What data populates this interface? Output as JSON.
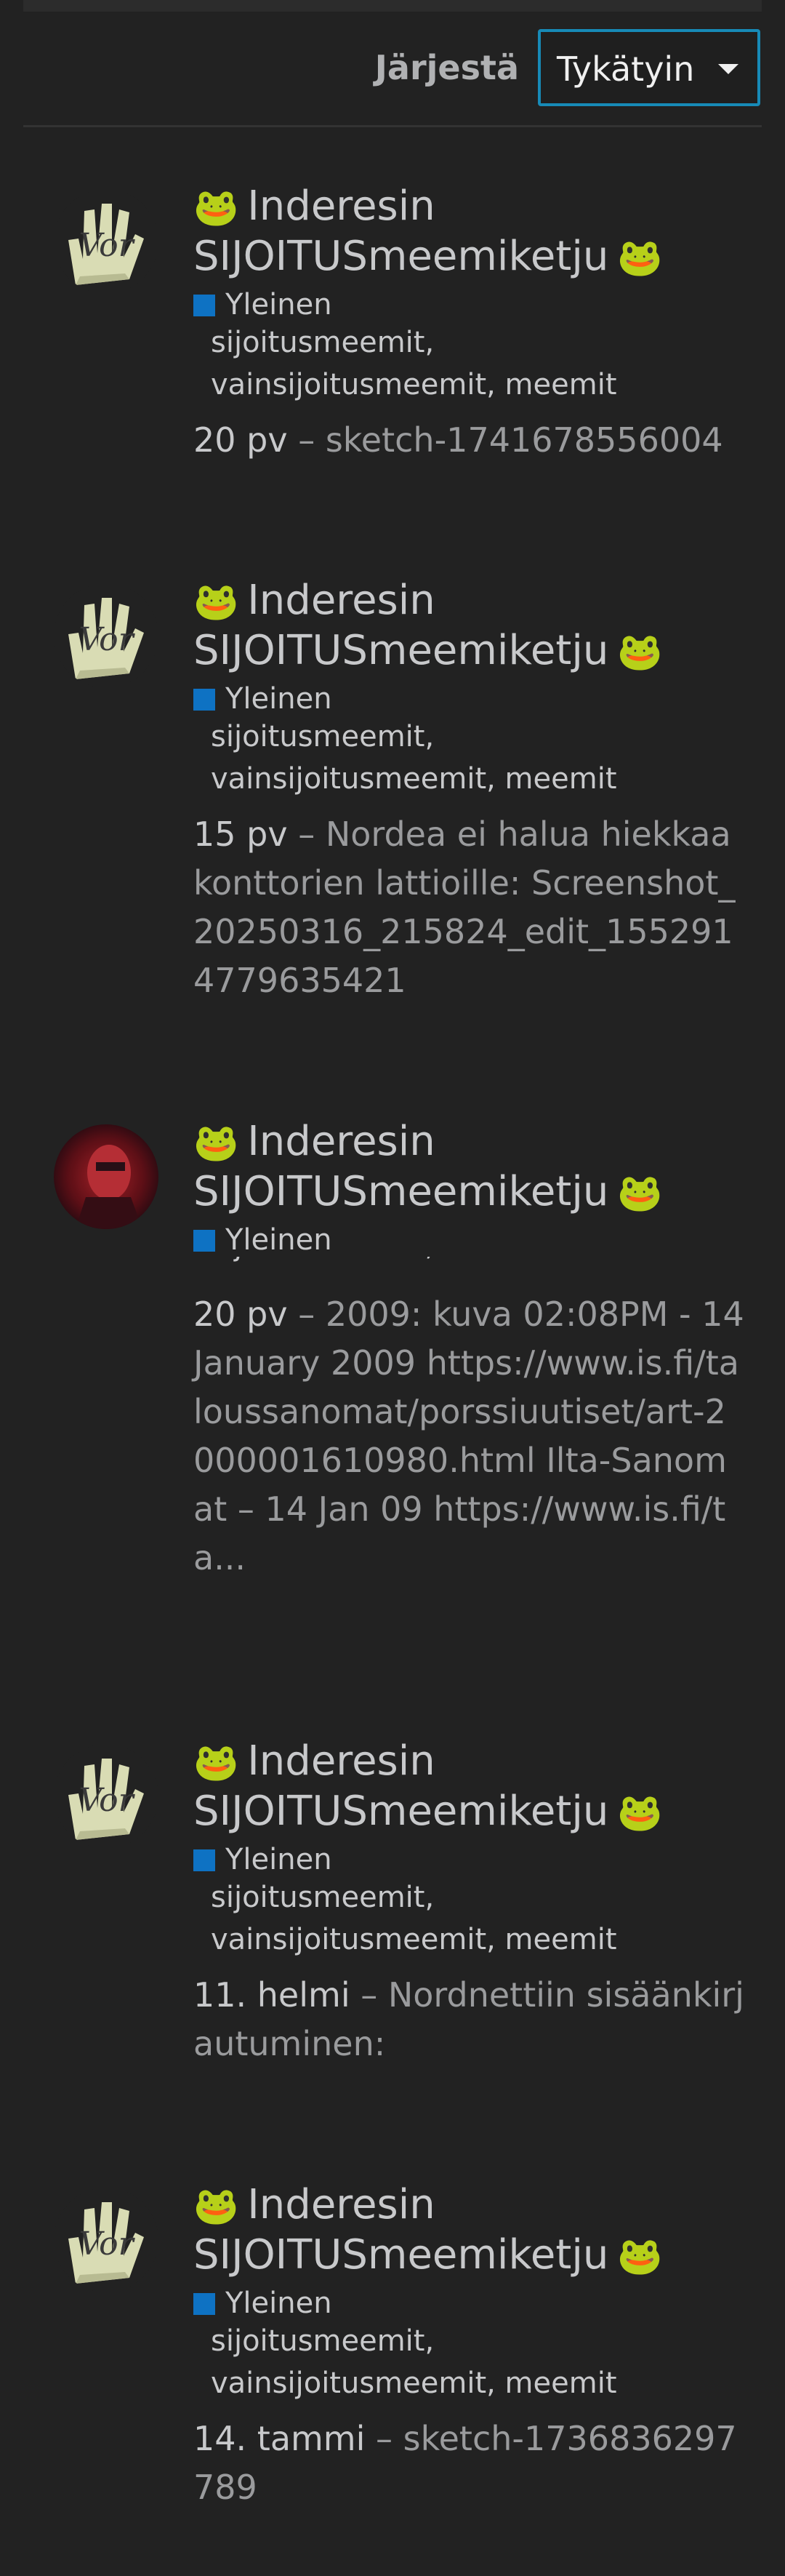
{
  "sort": {
    "label": "Järjestä",
    "selected": "Tykätyin"
  },
  "colors": {
    "background": "#222222",
    "accent": "#178ab7",
    "category": "#0e72c3"
  },
  "posts": [
    {
      "avatar_icon": "hand-avatar-icon",
      "title": "Inderesin SIJOITUSmeemiketju",
      "title_emoji": "🐸",
      "category": "Yleinen",
      "tags_line1": "sijoitusmeemit,",
      "tags_line2": "vainsijoitusmeemit, meemit",
      "date": "20 pv",
      "separator": " – ",
      "excerpt": "sketch-1741678556004"
    },
    {
      "avatar_icon": "hand-avatar-icon",
      "title": "Inderesin SIJOITUSmeemiketju",
      "title_emoji": "🐸",
      "category": "Yleinen",
      "tags_line1": "sijoitusmeemit,",
      "tags_line2": "vainsijoitusmeemit, meemit",
      "date": "15 pv",
      "separator": " – ",
      "excerpt": "Nordea ei halua hiekkaa konttorien lattioille: Screenshot_20250316_215824_edit_1552914779635421"
    },
    {
      "avatar_icon": "red-face-avatar-icon",
      "title": "Inderesin SIJOITUSmeemiketju",
      "title_emoji": "🐸",
      "category": "Yleinen",
      "tags_line1": "sijoitusmeemit,",
      "tags_line2": "",
      "date": "20 pv",
      "separator": " – ",
      "excerpt": "2009: kuva 02:08PM - 14 January 2009 https://www.is.fi/taloussanomat/porssiuutiset/art-2000001610980.html Ilta-Sanomat – 14 Jan 09 https://www.is.fi/ta..."
    },
    {
      "avatar_icon": "hand-avatar-icon",
      "title": "Inderesin SIJOITUSmeemiketju",
      "title_emoji": "🐸",
      "category": "Yleinen",
      "tags_line1": "sijoitusmeemit,",
      "tags_line2": "vainsijoitusmeemit, meemit",
      "date": "11. helmi",
      "separator": " – ",
      "excerpt": "Nordnettiin sisäänkirjautuminen:"
    },
    {
      "avatar_icon": "hand-avatar-icon",
      "title": "Inderesin SIJOITUSmeemiketju",
      "title_emoji": "🐸",
      "category": "Yleinen",
      "tags_line1": "sijoitusmeemit,",
      "tags_line2": "vainsijoitusmeemit, meemit",
      "date": "14. tammi",
      "separator": " – ",
      "excerpt": "sketch-1736836297789"
    }
  ]
}
